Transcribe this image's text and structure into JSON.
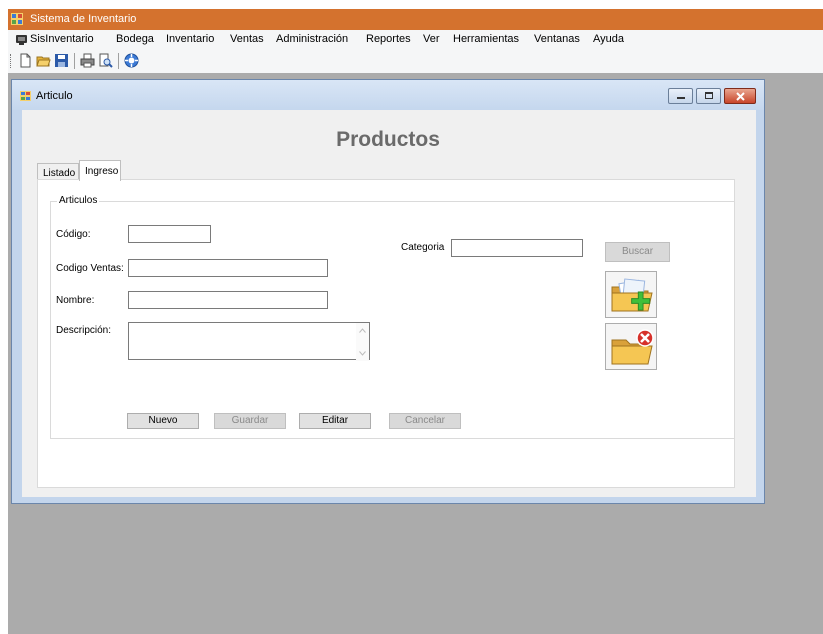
{
  "app": {
    "title": "Sistema de Inventario"
  },
  "menu": [
    "SisInventario",
    "Bodega",
    "Inventario",
    "Ventas",
    "Administración",
    "Reportes",
    "Ver",
    "Herramientas",
    "Ventanas",
    "Ayuda"
  ],
  "toolbar": {
    "icons": [
      "new-file-icon",
      "open-folder-icon",
      "save-icon",
      "print-icon",
      "print-preview-icon",
      "help-icon"
    ]
  },
  "window": {
    "title": "Articulo",
    "heading": "Productos"
  },
  "tabs": {
    "listado": "Listado",
    "ingreso": "Ingreso"
  },
  "group": {
    "label": "Articulos"
  },
  "form": {
    "codigo_label": "Código:",
    "codigo_ventas_label": "Codigo Ventas:",
    "nombre_label": "Nombre:",
    "descripcion_label": "Descripción:",
    "categoria_label": "Categoria",
    "codigo_value": "",
    "codigo_ventas_value": "",
    "nombre_value": "",
    "descripcion_value": "",
    "categoria_value": ""
  },
  "buttons": {
    "buscar": "Buscar",
    "nuevo": "Nuevo",
    "guardar": "Guardar",
    "editar": "Editar",
    "cancelar": "Cancelar"
  },
  "colors": {
    "app_titlebar": "#d4722e",
    "mdi_background": "#ababab",
    "heading": "#6a6a6a"
  }
}
